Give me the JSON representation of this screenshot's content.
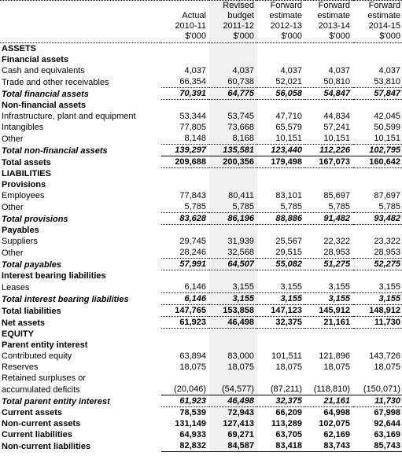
{
  "header": {
    "label_col": "",
    "columns": [
      {
        "name": "actual",
        "lines": [
          "",
          "Actual",
          "2010-11",
          "$'000"
        ],
        "shaded": false
      },
      {
        "name": "revised-budget",
        "lines": [
          "Revised",
          "budget",
          "2011-12",
          "$'000"
        ],
        "shaded": true
      },
      {
        "name": "forward-2012-13",
        "lines": [
          "Forward",
          "estimate",
          "2012-13",
          "$'000"
        ],
        "shaded": false
      },
      {
        "name": "forward-2013-14",
        "lines": [
          "Forward",
          "estimate",
          "2013-14",
          "$'000"
        ],
        "shaded": false
      },
      {
        "name": "forward-2014-15",
        "lines": [
          "Forward",
          "estimate",
          "2014-15",
          "$'000"
        ],
        "shaded": false
      }
    ]
  },
  "rows": [
    {
      "id": "assets",
      "label": "ASSETS",
      "style": "hdr-major",
      "indent": 0,
      "values": [
        "",
        "",
        "",
        "",
        ""
      ],
      "border_top": "none",
      "border_bottom": "none"
    },
    {
      "id": "financial-assets",
      "label": "Financial assets",
      "style": "sub-head",
      "indent": 0,
      "values": [
        "",
        "",
        "",
        "",
        ""
      ],
      "border_top": "none",
      "border_bottom": "none"
    },
    {
      "id": "cash-and-equivalents",
      "label": "Cash and equivalents",
      "style": "normal",
      "indent": 1,
      "values": [
        "4,037",
        "4,037",
        "4,037",
        "4,037",
        "4,037"
      ],
      "border_top": "none",
      "border_bottom": "none"
    },
    {
      "id": "trade-and-other-receivables",
      "label": "Trade and other receivables",
      "style": "normal",
      "indent": 1,
      "values": [
        "66,354",
        "60,738",
        "52,021",
        "50,810",
        "53,810"
      ],
      "border_top": "none",
      "border_bottom": "dotted"
    },
    {
      "id": "total-financial-assets",
      "label": "Total financial assets",
      "style": "total-it",
      "indent": 0,
      "values": [
        "70,391",
        "64,775",
        "56,058",
        "54,847",
        "57,847"
      ],
      "border_top": "none",
      "border_bottom": "dotted"
    },
    {
      "id": "non-financial-assets",
      "label": "Non-financial assets",
      "style": "sub-head",
      "indent": 0,
      "values": [
        "",
        "",
        "",
        "",
        ""
      ],
      "border_top": "none",
      "border_bottom": "none"
    },
    {
      "id": "infrastructure-plant-and-equipment",
      "label": "Infrastructure, plant and equipment",
      "style": "normal",
      "indent": 1,
      "values": [
        "53,344",
        "53,745",
        "47,710",
        "44,834",
        "42,045"
      ],
      "border_top": "none",
      "border_bottom": "none"
    },
    {
      "id": "intangibles",
      "label": "Intangibles",
      "style": "normal",
      "indent": 1,
      "values": [
        "77,805",
        "73,668",
        "65,579",
        "57,241",
        "50,599"
      ],
      "border_top": "none",
      "border_bottom": "none"
    },
    {
      "id": "other-non-financial",
      "label": "Other",
      "style": "normal",
      "indent": 1,
      "values": [
        "8,148",
        "8,168",
        "10,151",
        "10,151",
        "10,151"
      ],
      "border_top": "none",
      "border_bottom": "dotted"
    },
    {
      "id": "total-non-financial-assets",
      "label": "Total non-financial assets",
      "style": "total-it",
      "indent": 0,
      "values": [
        "139,297",
        "135,581",
        "123,440",
        "112,226",
        "102,795"
      ],
      "border_top": "none",
      "border_bottom": "solid"
    },
    {
      "id": "total-assets",
      "label": "Total assets",
      "style": "total-bd",
      "indent": 0,
      "values": [
        "209,688",
        "200,356",
        "179,498",
        "167,073",
        "160,642"
      ],
      "border_top": "none",
      "border_bottom": "dotted"
    },
    {
      "id": "liabilities",
      "label": "LIABILITIES",
      "style": "hdr-major",
      "indent": 0,
      "values": [
        "",
        "",
        "",
        "",
        ""
      ],
      "border_top": "none",
      "border_bottom": "none"
    },
    {
      "id": "provisions",
      "label": "Provisions",
      "style": "sub-head",
      "indent": 0,
      "values": [
        "",
        "",
        "",
        "",
        ""
      ],
      "border_top": "none",
      "border_bottom": "none"
    },
    {
      "id": "employees",
      "label": "Employees",
      "style": "normal",
      "indent": 1,
      "values": [
        "77,843",
        "80,411",
        "83,101",
        "85,697",
        "87,697"
      ],
      "border_top": "none",
      "border_bottom": "none"
    },
    {
      "id": "other-provisions",
      "label": "Other",
      "style": "normal",
      "indent": 1,
      "values": [
        "5,785",
        "5,785",
        "5,785",
        "5,785",
        "5,785"
      ],
      "border_top": "none",
      "border_bottom": "dotted"
    },
    {
      "id": "total-provisions",
      "label": "Total provisions",
      "style": "total-it",
      "indent": 0,
      "values": [
        "83,628",
        "86,196",
        "88,886",
        "91,482",
        "93,482"
      ],
      "border_top": "none",
      "border_bottom": "dotted"
    },
    {
      "id": "payables",
      "label": "Payables",
      "style": "sub-head",
      "indent": 0,
      "values": [
        "",
        "",
        "",
        "",
        ""
      ],
      "border_top": "none",
      "border_bottom": "none"
    },
    {
      "id": "suppliers",
      "label": "Suppliers",
      "style": "normal",
      "indent": 1,
      "values": [
        "29,745",
        "31,939",
        "25,567",
        "22,322",
        "23,322"
      ],
      "border_top": "none",
      "border_bottom": "none"
    },
    {
      "id": "other-payables",
      "label": "Other",
      "style": "normal",
      "indent": 1,
      "values": [
        "28,246",
        "32,568",
        "29,515",
        "28,953",
        "28,953"
      ],
      "border_top": "none",
      "border_bottom": "dotted"
    },
    {
      "id": "total-payables",
      "label": "Total payables",
      "style": "total-it",
      "indent": 0,
      "values": [
        "57,991",
        "64,507",
        "55,082",
        "51,275",
        "52,275"
      ],
      "border_top": "none",
      "border_bottom": "dotted"
    },
    {
      "id": "interest-bearing-liabilities",
      "label": "Interest bearing liabilities",
      "style": "sub-head",
      "indent": 0,
      "values": [
        "",
        "",
        "",
        "",
        ""
      ],
      "border_top": "none",
      "border_bottom": "none"
    },
    {
      "id": "leases",
      "label": "Leases",
      "style": "normal",
      "indent": 1,
      "values": [
        "6,146",
        "3,155",
        "3,155",
        "3,155",
        "3,155"
      ],
      "border_top": "none",
      "border_bottom": "dotted"
    },
    {
      "id": "total-interest-bearing-liabilities",
      "label": "Total interest bearing liabilities",
      "style": "total-it",
      "indent": 0,
      "values": [
        "6,146",
        "3,155",
        "3,155",
        "3,155",
        "3,155"
      ],
      "border_top": "none",
      "border_bottom": "dotted"
    },
    {
      "id": "total-liabilities",
      "label": "Total liabilities",
      "style": "total-bd",
      "indent": 0,
      "values": [
        "147,765",
        "153,858",
        "147,123",
        "145,912",
        "148,912"
      ],
      "border_top": "none",
      "border_bottom": "dotted"
    },
    {
      "id": "net-assets",
      "label": "Net assets",
      "style": "total-bd",
      "indent": 0,
      "values": [
        "61,923",
        "46,498",
        "32,375",
        "21,161",
        "11,730"
      ],
      "border_top": "none",
      "border_bottom": "dotted"
    },
    {
      "id": "equity",
      "label": "EQUITY",
      "style": "hdr-major",
      "indent": 0,
      "values": [
        "",
        "",
        "",
        "",
        ""
      ],
      "border_top": "none",
      "border_bottom": "none"
    },
    {
      "id": "parent-entity-interest",
      "label": "Parent entity interest",
      "style": "sub-head",
      "indent": 0,
      "values": [
        "",
        "",
        "",
        "",
        ""
      ],
      "border_top": "none",
      "border_bottom": "none"
    },
    {
      "id": "contributed-equity",
      "label": "Contributed equity",
      "style": "normal",
      "indent": 1,
      "values": [
        "63,894",
        "83,000",
        "101,511",
        "121,896",
        "143,726"
      ],
      "border_top": "none",
      "border_bottom": "none"
    },
    {
      "id": "reserves",
      "label": "Reserves",
      "style": "normal",
      "indent": 1,
      "values": [
        "18,075",
        "18,075",
        "18,075",
        "18,075",
        "18,075"
      ],
      "border_top": "none",
      "border_bottom": "none"
    },
    {
      "id": "retained-surpluses-line1",
      "label": "Retained surpluses or",
      "style": "normal",
      "indent": 1,
      "values": [
        "",
        "",
        "",
        "",
        ""
      ],
      "border_top": "none",
      "border_bottom": "none"
    },
    {
      "id": "accumulated-deficits",
      "label": "accumulated deficits",
      "style": "normal",
      "indent": 2,
      "values": [
        "(20,046)",
        "(54,577)",
        "(87,211)",
        "(118,810)",
        "(150,071)"
      ],
      "border_top": "none",
      "border_bottom": "solid"
    },
    {
      "id": "total-parent-entity-interest",
      "label": "Total parent entity interest",
      "style": "total-it",
      "indent": 0,
      "values": [
        "61,923",
        "46,498",
        "32,375",
        "21,161",
        "11,730"
      ],
      "border_top": "none",
      "border_bottom": "dotted"
    },
    {
      "id": "current-assets",
      "label": "Current assets",
      "style": "total-bd",
      "indent": 0,
      "values": [
        "78,539",
        "72,943",
        "66,209",
        "64,998",
        "67,998"
      ],
      "border_top": "none",
      "border_bottom": "none"
    },
    {
      "id": "non-current-assets",
      "label": "Non-current assets",
      "style": "total-bd",
      "indent": 0,
      "values": [
        "131,149",
        "127,413",
        "113,289",
        "102,075",
        "92,644"
      ],
      "border_top": "none",
      "border_bottom": "none"
    },
    {
      "id": "current-liabilities",
      "label": "Current liabilities",
      "style": "total-bd",
      "indent": 0,
      "values": [
        "64,933",
        "69,271",
        "63,705",
        "62,169",
        "63,169"
      ],
      "border_top": "none",
      "border_bottom": "none"
    },
    {
      "id": "non-current-liabilities",
      "label": "Non-current liabilities",
      "style": "total-bd",
      "indent": 0,
      "values": [
        "82,832",
        "84,587",
        "83,418",
        "83,743",
        "85,743"
      ],
      "border_top": "none",
      "border_bottom": "solid"
    }
  ],
  "colors": {
    "shaded_column": "#f0f0f0",
    "rule": "#000000",
    "text": "#000000",
    "background": "#ffffff"
  }
}
